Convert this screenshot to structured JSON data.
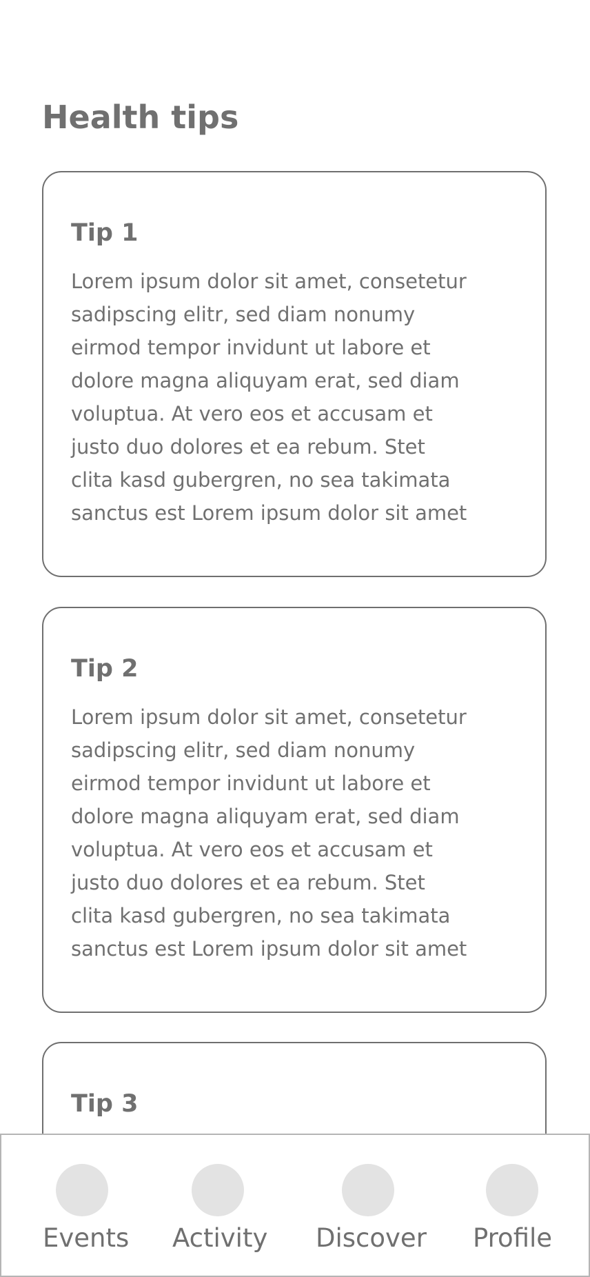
{
  "page": {
    "title": "Health tips"
  },
  "tips": [
    {
      "title": "Tip 1",
      "lines": [
        "Lorem ipsum dolor sit amet, consetetur",
        "sadipscing elitr, sed diam nonumy",
        "eirmod tempor invidunt ut labore et",
        "dolore magna aliquyam erat, sed diam",
        "voluptua. At vero eos et accusam et",
        "justo duo dolores et ea rebum. Stet",
        "clita kasd gubergren, no sea takimata",
        "sanctus est Lorem ipsum dolor sit amet"
      ]
    },
    {
      "title": "Tip 2",
      "lines": [
        "Lorem ipsum dolor sit amet, consetetur",
        "sadipscing elitr, sed diam nonumy",
        "eirmod tempor invidunt ut labore et",
        "dolore magna aliquyam erat, sed diam",
        "voluptua. At vero eos et accusam et",
        "justo duo dolores et ea rebum. Stet",
        "clita kasd gubergren, no sea takimata",
        "sanctus est Lorem ipsum dolor sit amet"
      ]
    },
    {
      "title": "Tip 3"
    }
  ],
  "bottom_nav": {
    "items": [
      {
        "label": "Events",
        "icon": "events-icon"
      },
      {
        "label": "Activity",
        "icon": "activity-icon"
      },
      {
        "label": "Discover",
        "icon": "discover-icon"
      },
      {
        "label": "Profile",
        "icon": "profile-icon"
      }
    ]
  },
  "colors": {
    "text": "#707070",
    "card_border": "#6f6f6f",
    "nav_border": "#b5b5b5",
    "icon_placeholder": "#e3e3e3",
    "background": "#ffffff"
  }
}
